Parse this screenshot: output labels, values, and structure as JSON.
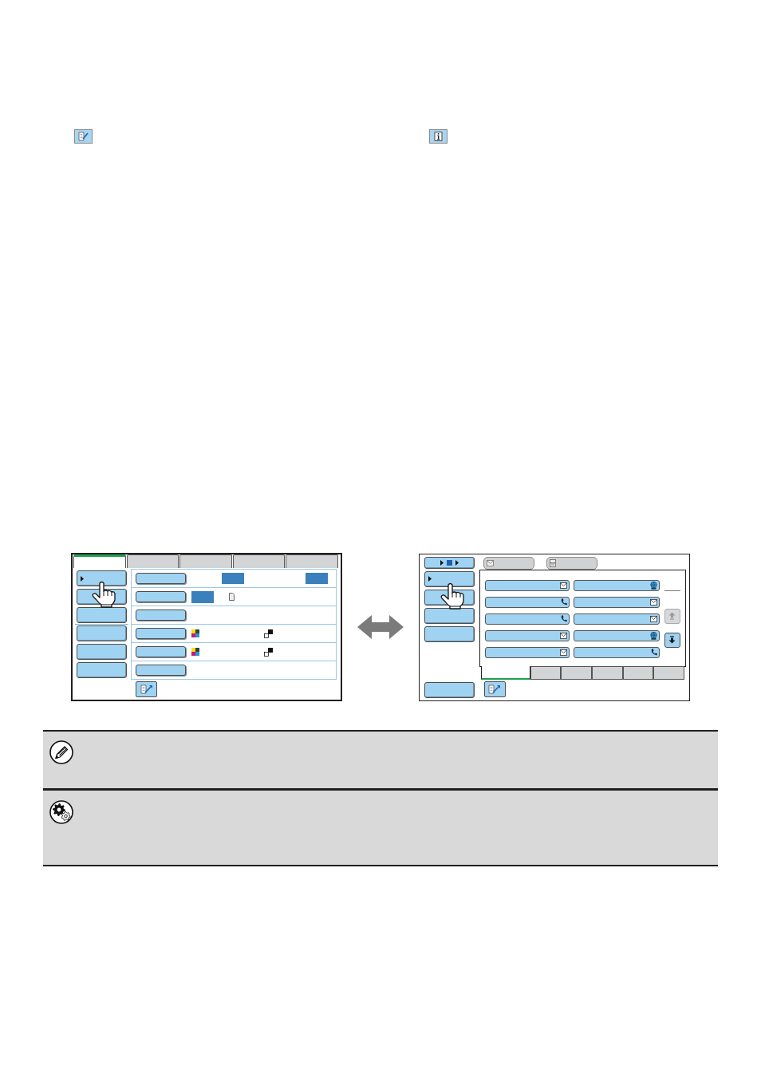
{
  "page_icons": [
    {
      "kind": "document_pen"
    },
    {
      "kind": "info"
    }
  ],
  "left_screen": {
    "tabs": [
      {
        "selected": true
      },
      {
        "selected": false
      },
      {
        "selected": false
      },
      {
        "selected": false
      },
      {
        "selected": false
      }
    ],
    "side_buttons": [
      {
        "kind": "arrow"
      },
      {
        "kind": "plain"
      },
      {
        "kind": "plain"
      },
      {
        "kind": "plain"
      },
      {
        "kind": "plain"
      },
      {
        "kind": "plain"
      }
    ],
    "rows": [
      {
        "kind": "two_values"
      },
      {
        "kind": "value_document"
      },
      {
        "kind": "plain"
      },
      {
        "kind": "color_modes"
      },
      {
        "kind": "color_modes"
      },
      {
        "kind": "plain"
      }
    ]
  },
  "right_screen": {
    "mode_tabs": [
      {
        "kind": "email"
      },
      {
        "kind": "fax"
      }
    ],
    "side_buttons": [
      {
        "kind": "status"
      },
      {
        "kind": "arrow"
      },
      {
        "kind": "plain"
      },
      {
        "kind": "plain"
      },
      {
        "kind": "plain"
      }
    ],
    "addresses": [
      {
        "kind": "email"
      },
      {
        "kind": "ftp"
      },
      {
        "kind": "fax"
      },
      {
        "kind": "email"
      },
      {
        "kind": "fax"
      },
      {
        "kind": "email"
      },
      {
        "kind": "email"
      },
      {
        "kind": "ftp"
      },
      {
        "kind": "email"
      },
      {
        "kind": "fax"
      }
    ],
    "scroll_buttons": [
      {
        "kind": "up",
        "disabled": true
      },
      {
        "kind": "down",
        "disabled": false
      }
    ],
    "tabs": [
      {
        "selected": true
      },
      {
        "selected": false
      },
      {
        "selected": false
      },
      {
        "selected": false
      },
      {
        "selected": false
      },
      {
        "selected": false
      }
    ]
  },
  "notes": [
    {
      "kind": "note"
    },
    {
      "kind": "settings"
    }
  ]
}
